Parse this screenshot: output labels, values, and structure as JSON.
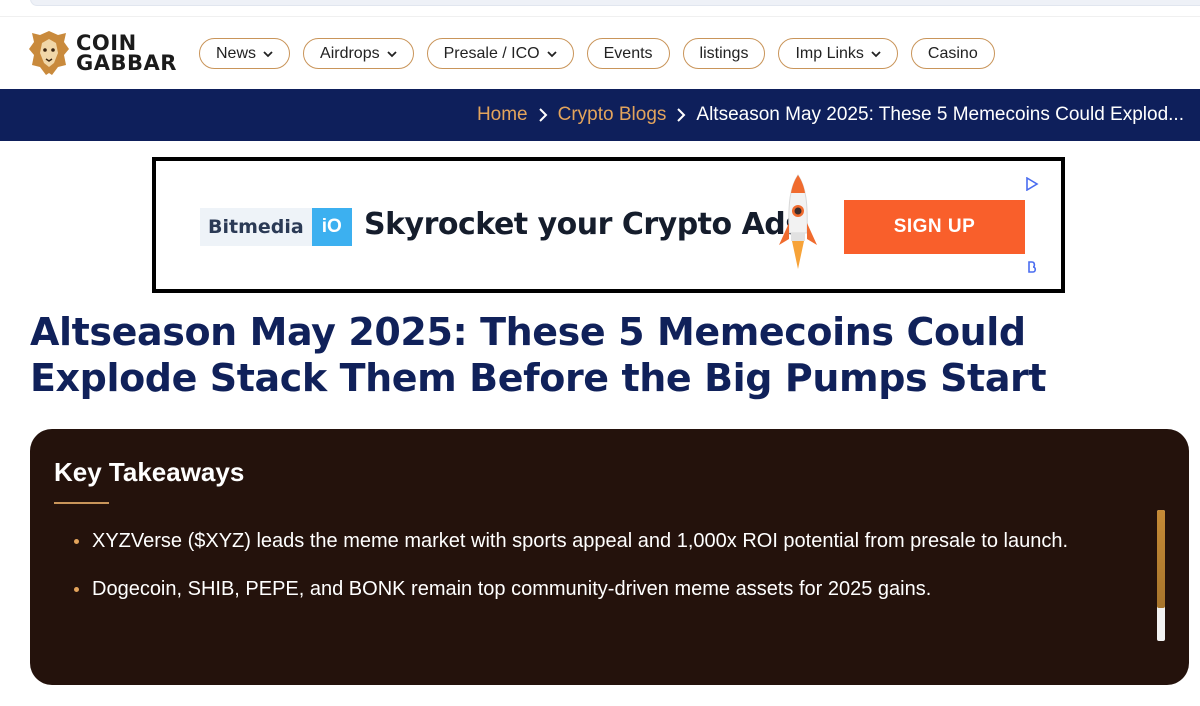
{
  "site": {
    "logo_line1": "COIN",
    "logo_line2": "GABBAR"
  },
  "nav": {
    "items": [
      {
        "label": "News",
        "dropdown": true
      },
      {
        "label": "Airdrops",
        "dropdown": true
      },
      {
        "label": "Presale / ICO",
        "dropdown": true
      },
      {
        "label": "Events",
        "dropdown": false
      },
      {
        "label": "listings",
        "dropdown": false
      },
      {
        "label": "Imp Links",
        "dropdown": true
      },
      {
        "label": "Casino",
        "dropdown": false
      }
    ]
  },
  "breadcrumb": {
    "home": "Home",
    "section": "Crypto Blogs",
    "current": "Altseason May 2025: These 5 Memecoins Could Explod..."
  },
  "ad": {
    "brand_left": "Bitmedia",
    "brand_right": "iO",
    "headline": "Skyrocket your Crypto Ads",
    "cta": "SIGN UP"
  },
  "article": {
    "title": "Altseason May 2025: These 5 Memecoins Could Explode Stack Them Before the Big Pumps Start"
  },
  "takeaways": {
    "heading": "Key Takeaways",
    "items": [
      "XYZVerse ($XYZ) leads the meme market with sports appeal and 1,000x ROI potential from presale to launch.",
      "Dogecoin, SHIB, PEPE, and BONK remain top community-driven meme assets for 2025 gains."
    ]
  },
  "colors": {
    "navy": "#0e1f5b",
    "gold": "#e3a45c",
    "panel": "#24120c",
    "cta": "#f95f2b"
  }
}
